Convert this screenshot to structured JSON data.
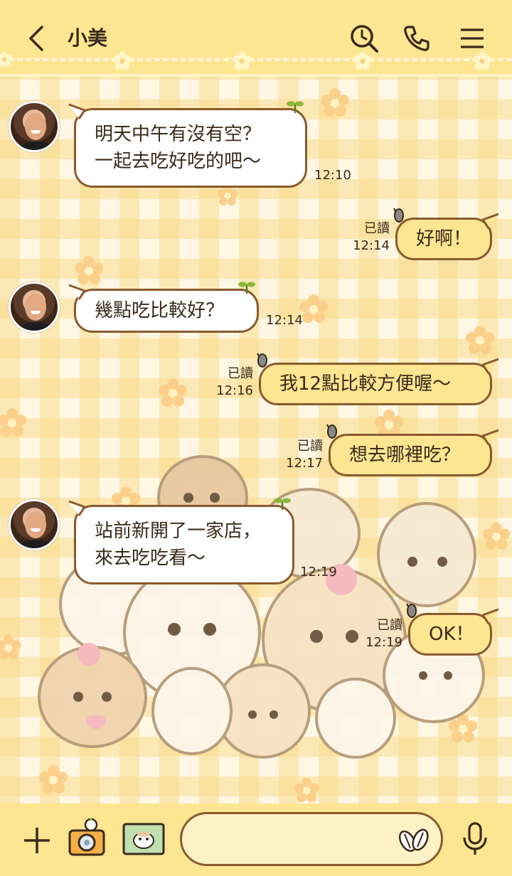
{
  "header": {
    "title": "小美",
    "icons": [
      "back-chevron-icon",
      "search-clock-icon",
      "phone-icon",
      "menu-icon"
    ]
  },
  "messages": [
    {
      "side": "in",
      "lines": [
        "明天中午有沒有空？",
        "一起去吃好吃的吧～"
      ],
      "time": "12:10"
    },
    {
      "side": "out",
      "lines": [
        "好啊！"
      ],
      "read": "已讀",
      "time": "12:14"
    },
    {
      "side": "in",
      "lines": [
        "幾點吃比較好？"
      ],
      "time": "12:14"
    },
    {
      "side": "out",
      "lines": [
        "我12點比較方便喔～"
      ],
      "read": "已讀",
      "time": "12:16"
    },
    {
      "side": "out",
      "lines": [
        "想去哪裡吃？"
      ],
      "read": "已讀",
      "time": "12:17"
    },
    {
      "side": "in",
      "lines": [
        "站前新開了一家店，",
        "來去吃吃看～"
      ],
      "time": "12:19"
    },
    {
      "side": "out",
      "lines": [
        "OK！"
      ],
      "read": "已讀",
      "time": "12:19"
    }
  ],
  "footer": {
    "input_placeholder": "",
    "icons": [
      "plus-icon",
      "camera-icon",
      "photo-icon",
      "sticker-seeds-icon",
      "microphone-icon"
    ]
  },
  "colors": {
    "header_bg": "#fde592",
    "outline": "#8a5a2e",
    "out_bubble": "#fde592",
    "in_bubble": "#ffffff",
    "background": "#fdf7e4"
  }
}
